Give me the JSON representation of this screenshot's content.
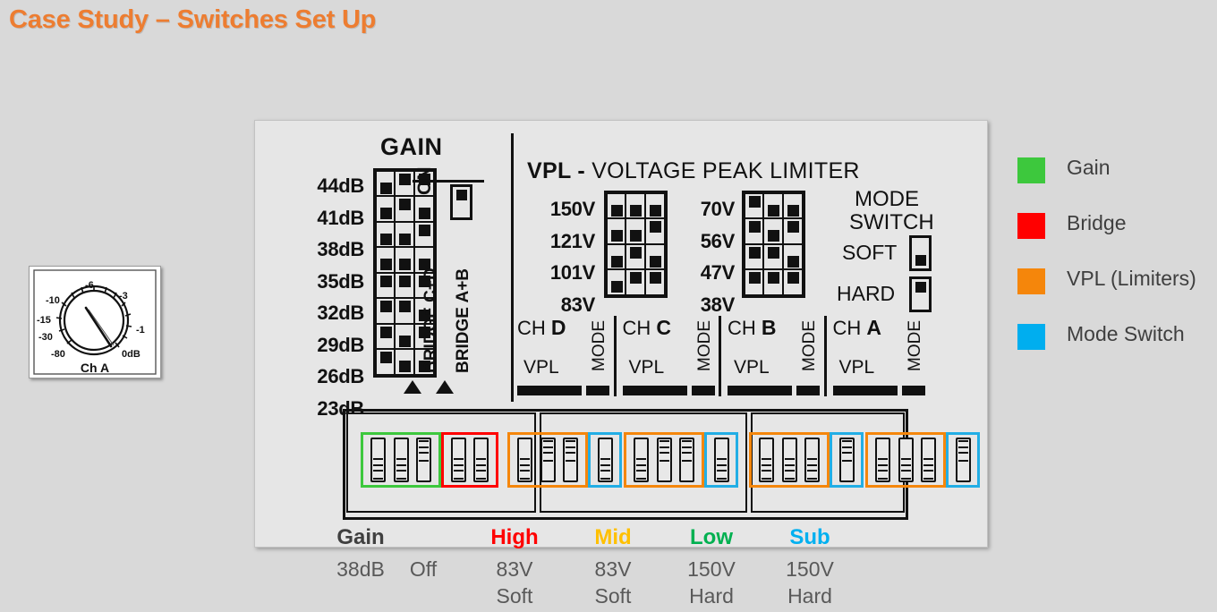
{
  "title": "Case Study – Switches Set Up",
  "title_color": "#ED7D31",
  "knob": {
    "channel_label": "Ch  A",
    "ticks": [
      "-80",
      "-30",
      "-15",
      "-10",
      "-6",
      "-3",
      "-1",
      "0dB"
    ]
  },
  "panel": {
    "gain": {
      "heading": "GAIN",
      "rows": [
        {
          "label": "44dB",
          "switches": [
            "down",
            "up",
            "up"
          ]
        },
        {
          "label": "41dB",
          "switches": [
            "down",
            "up",
            "down"
          ]
        },
        {
          "label": "38dB",
          "switches": [
            "down",
            "down",
            "up"
          ]
        },
        {
          "label": "35dB",
          "switches": [
            "down",
            "down",
            "down"
          ]
        },
        {
          "label": "32dB",
          "switches": [
            "up",
            "up",
            "up"
          ]
        },
        {
          "label": "29dB",
          "switches": [
            "up",
            "up",
            "down"
          ]
        },
        {
          "label": "26dB",
          "switches": [
            "up",
            "down",
            "up"
          ]
        },
        {
          "label": "23dB",
          "switches": [
            "up",
            "down",
            "down"
          ]
        }
      ],
      "on_label": "ON",
      "on_switch": "up",
      "bridge_cd_label": "BRIDGE C+D",
      "bridge_ab_label": "BRIDGE A+B"
    },
    "vpl": {
      "heading_bold": "VPL -",
      "heading_rest": " VOLTAGE PEAK LIMITER",
      "left_rows": [
        {
          "label": "150V",
          "switches": [
            "down",
            "down",
            "down"
          ]
        },
        {
          "label": "121V",
          "switches": [
            "down",
            "down",
            "up"
          ]
        },
        {
          "label": "101V",
          "switches": [
            "down",
            "up",
            "down"
          ]
        },
        {
          "label": "83V",
          "switches": [
            "down",
            "up",
            "up"
          ]
        }
      ],
      "right_rows": [
        {
          "label": "70V",
          "switches": [
            "up",
            "down",
            "down"
          ]
        },
        {
          "label": "56V",
          "switches": [
            "up",
            "down",
            "up"
          ]
        },
        {
          "label": "47V",
          "switches": [
            "up",
            "up",
            "down"
          ]
        },
        {
          "label": "38V",
          "switches": [
            "up",
            "up",
            "up"
          ]
        }
      ]
    },
    "mode_switch": {
      "title_line1": "MODE",
      "title_line2": "SWITCH",
      "soft_label": "SOFT",
      "soft_position": "down",
      "hard_label": "HARD",
      "hard_position": "up"
    },
    "channels": [
      {
        "prefix": "CH ",
        "letter": "D",
        "vpl_label": "VPL",
        "mode_label": "MODE"
      },
      {
        "prefix": "CH ",
        "letter": "C",
        "vpl_label": "VPL",
        "mode_label": "MODE"
      },
      {
        "prefix": "CH ",
        "letter": "B",
        "vpl_label": "VPL",
        "mode_label": "MODE"
      },
      {
        "prefix": "CH ",
        "letter": "A",
        "vpl_label": "VPL",
        "mode_label": "MODE"
      }
    ],
    "dip_bank": {
      "groups": [
        {
          "color": "#3DC83D",
          "role": "Gain",
          "switches": [
            "down",
            "down",
            "up"
          ]
        },
        {
          "color": "#FF0000",
          "role": "Bridge",
          "switches": [
            "down",
            "down"
          ]
        },
        {
          "color": "#F5860B",
          "role": "VPL",
          "switches": [
            "down",
            "up",
            "up"
          ]
        },
        {
          "color": "#22AEE5",
          "role": "Mode Switch",
          "switches": [
            "down"
          ]
        },
        {
          "color": "#F5860B",
          "role": "VPL",
          "switches": [
            "down",
            "up",
            "up"
          ]
        },
        {
          "color": "#22AEE5",
          "role": "Mode Switch",
          "switches": [
            "down"
          ]
        },
        {
          "color": "#F5860B",
          "role": "VPL",
          "switches": [
            "down",
            "down",
            "down"
          ]
        },
        {
          "color": "#22AEE5",
          "role": "Mode Switch",
          "switches": [
            "up"
          ]
        },
        {
          "color": "#F5860B",
          "role": "VPL",
          "switches": [
            "down",
            "down",
            "down"
          ]
        },
        {
          "color": "#22AEE5",
          "role": "Mode Switch",
          "switches": [
            "up"
          ]
        }
      ]
    },
    "bottom_labels": [
      {
        "text": "Gain",
        "color": "#404040",
        "values": [
          "38dB",
          ""
        ]
      },
      {
        "text": "",
        "color": "#404040",
        "values": [
          "Off",
          ""
        ]
      },
      {
        "text": "High",
        "color": "#FF0000",
        "values": [
          "83V",
          "Soft"
        ]
      },
      {
        "text": "Mid",
        "color": "#FFC000",
        "values": [
          "83V",
          "Soft"
        ]
      },
      {
        "text": "Low",
        "color": "#00B050",
        "values": [
          "150V",
          "Hard"
        ]
      },
      {
        "text": "Sub",
        "color": "#00B0F0",
        "values": [
          "150V",
          "Hard"
        ]
      }
    ]
  },
  "legend": [
    {
      "color": "#3DC83D",
      "label": "Gain"
    },
    {
      "color": "#FF0000",
      "label": "Bridge"
    },
    {
      "color": "#F5860B",
      "label": "VPL (Limiters)"
    },
    {
      "color": "#00AEEF",
      "label": "Mode Switch"
    }
  ]
}
